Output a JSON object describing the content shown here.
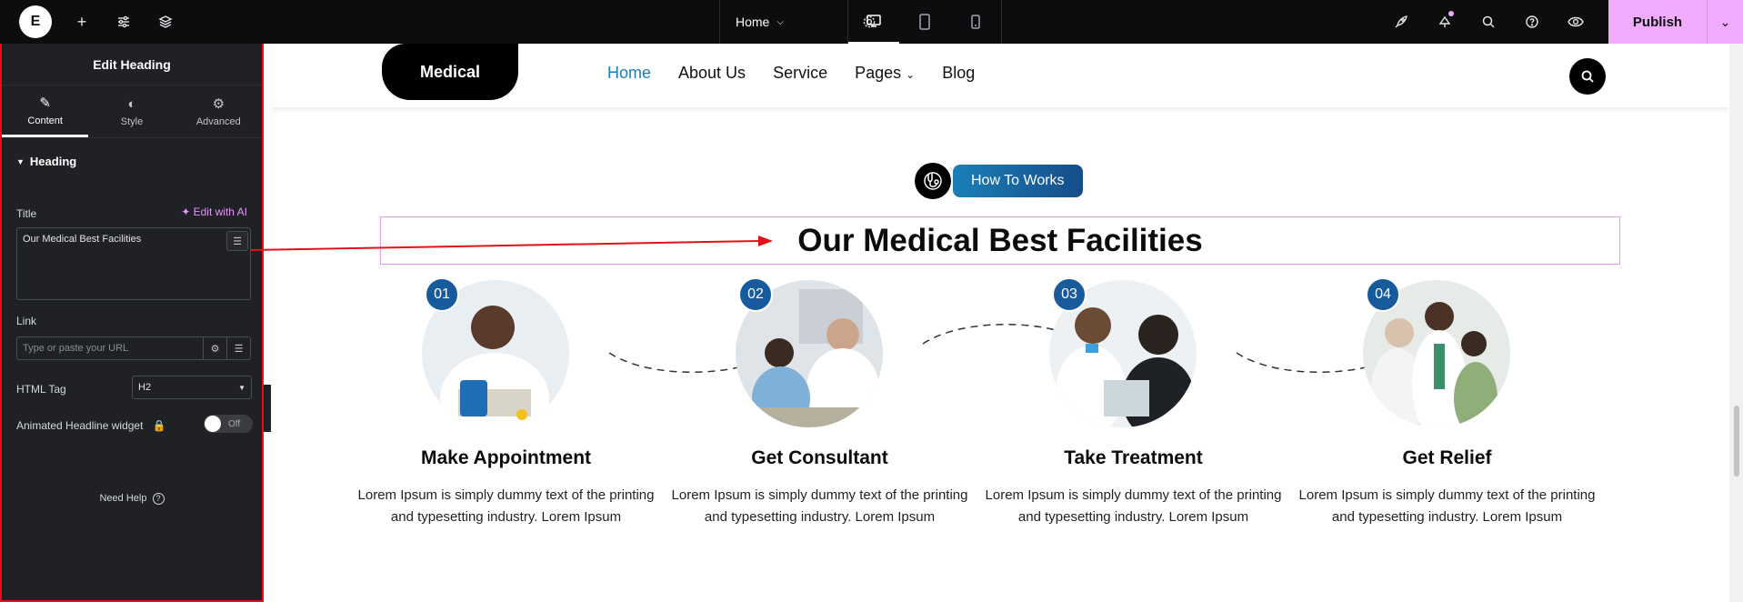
{
  "topbar": {
    "logo_glyph": "E",
    "page_name": "Home",
    "publish_label": "Publish"
  },
  "panel": {
    "title": "Edit Heading",
    "tabs": [
      {
        "label": "Content",
        "icon": "pencil-icon"
      },
      {
        "label": "Style",
        "icon": "contrast-icon"
      },
      {
        "label": "Advanced",
        "icon": "gear-icon"
      }
    ],
    "section_title": "Heading",
    "title_label": "Title",
    "edit_ai_label": "Edit with AI",
    "title_value": "Our Medical Best Facilities",
    "link_label": "Link",
    "link_placeholder": "Type or paste your URL",
    "html_tag_label": "HTML Tag",
    "html_tag_value": "H2",
    "animated_label": "Animated Headline widget",
    "toggle_state": "Off",
    "need_help": "Need Help"
  },
  "site": {
    "logo": "Medical",
    "nav": [
      "Home",
      "About Us",
      "Service",
      "Pages",
      "Blog"
    ],
    "badge": "How To Works",
    "heading": "Our Medical Best Facilities",
    "steps": [
      {
        "num": "01",
        "title": "Make Appointment",
        "text": "Lorem Ipsum is simply dummy text of the printing and typesetting industry. Lorem Ipsum"
      },
      {
        "num": "02",
        "title": "Get Consultant",
        "text": "Lorem Ipsum is simply dummy text of the printing and typesetting industry. Lorem Ipsum"
      },
      {
        "num": "03",
        "title": "Take Treatment",
        "text": "Lorem Ipsum is simply dummy text of the printing and typesetting industry. Lorem Ipsum"
      },
      {
        "num": "04",
        "title": "Get Relief",
        "text": "Lorem Ipsum is simply dummy text of the printing and typesetting industry. Lorem Ipsum"
      }
    ]
  },
  "colors": {
    "accent": "#f0abfc",
    "nav_active": "#1a7fb4",
    "step_badge": "#175b9d",
    "annotation": "#e3101a"
  }
}
